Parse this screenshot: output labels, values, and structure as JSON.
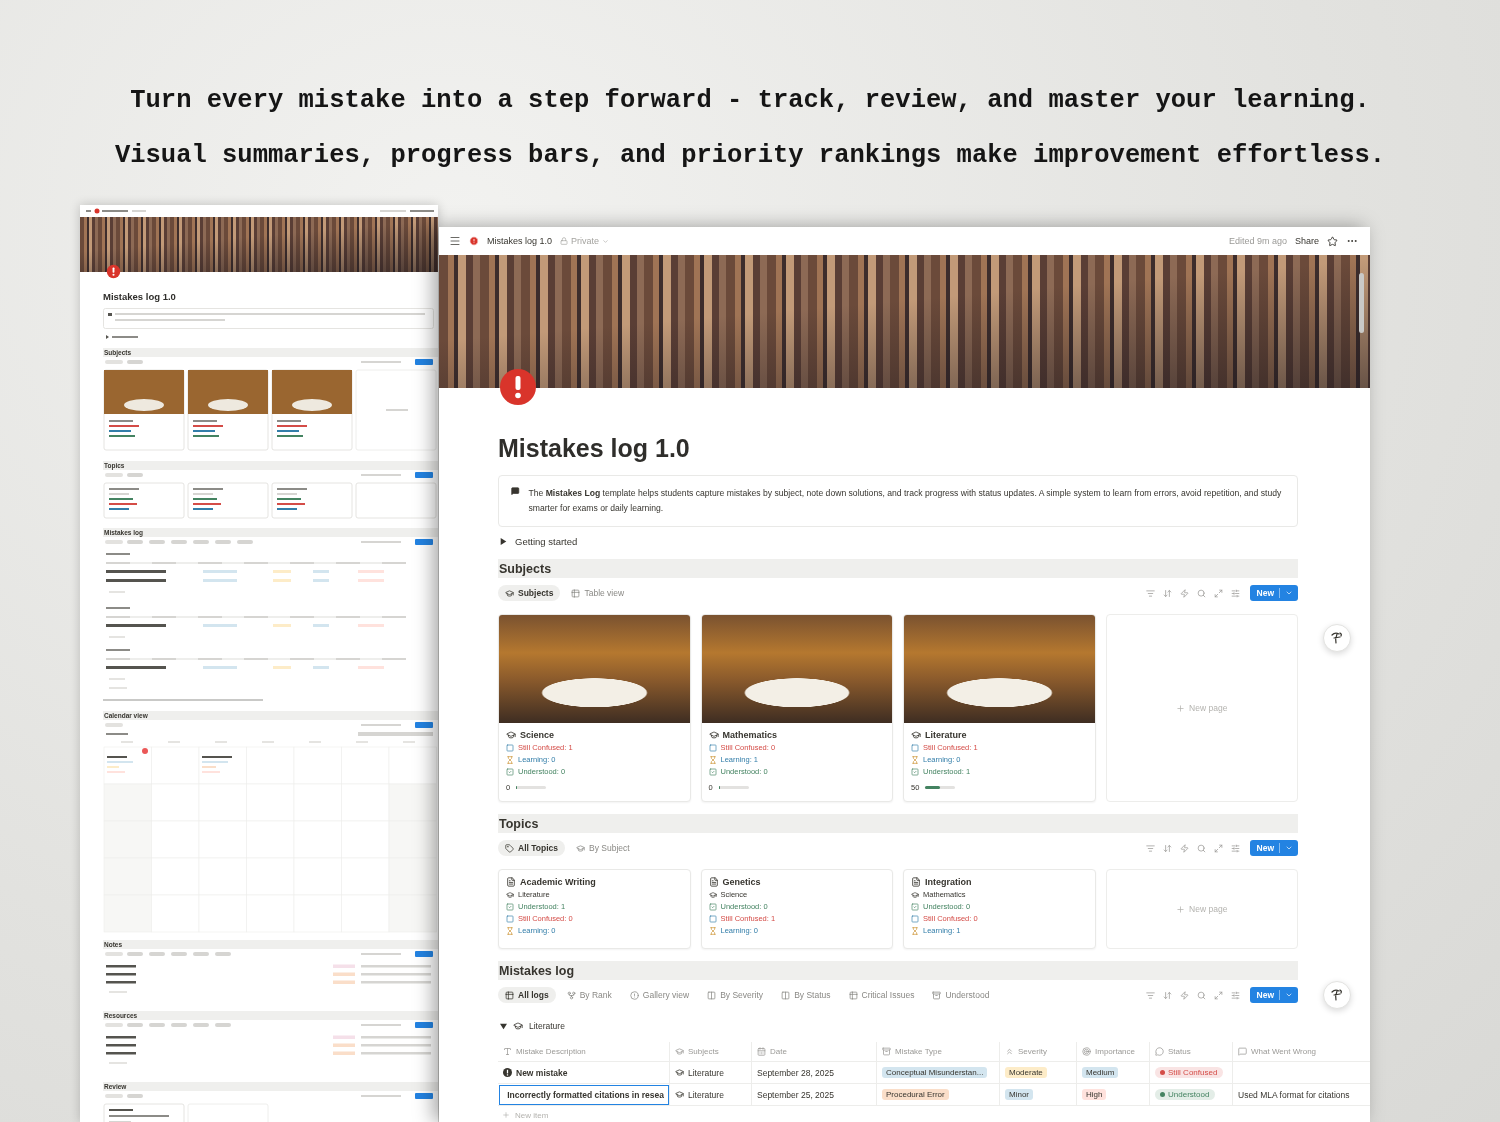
{
  "headline": [
    "Turn every mistake into a step forward - track, review, and master your learning.",
    "Visual summaries, progress bars, and priority rankings make improvement effortless."
  ],
  "back_page": {
    "title": "Mistakes log 1.0",
    "sections": [
      {
        "title": "Subjects",
        "kind": "photo_gallery"
      },
      {
        "title": "Topics",
        "kind": "gallery"
      },
      {
        "title": "Mistakes log",
        "kind": "table"
      },
      {
        "title": "Calendar view",
        "kind": "calendar"
      },
      {
        "title": "Notes",
        "kind": "list"
      },
      {
        "title": "Resources",
        "kind": "list"
      },
      {
        "title": "Review",
        "kind": "board"
      }
    ]
  },
  "front_page": {
    "topbar": {
      "title": "Mistakes log 1.0",
      "privacy": "Private",
      "edited": "Edited 9m ago",
      "share": "Share"
    },
    "title": "Mistakes log 1.0",
    "description": "The **Mistakes Log** template helps students capture mistakes by subject, note down solutions, and track progress with status updates. A simple system to learn from errors, avoid repetition, and study smarter for exams or daily learning.",
    "toggle": "Getting started",
    "sections": [
      {
        "title": "Subjects",
        "views": [
          {
            "label": "Subjects",
            "kind": "subject",
            "selected": true
          },
          {
            "label": "Table view",
            "kind": "table",
            "selected": false
          }
        ],
        "new_button": "New",
        "body": {
          "kind": "photo_gallery",
          "new_page": "New page",
          "cards": [
            {
              "name": "Science",
              "lines": [
                {
                  "kind": "confused",
                  "text": "Still Confused: 1"
                },
                {
                  "kind": "learning",
                  "text": "Learning: 0"
                },
                {
                  "kind": "understood",
                  "text": "Understood: 0"
                }
              ],
              "progress": {
                "text": "0",
                "level": 0
              }
            },
            {
              "name": "Mathematics",
              "lines": [
                {
                  "kind": "confused",
                  "text": "Still Confused: 0"
                },
                {
                  "kind": "learning",
                  "text": "Learning: 1"
                },
                {
                  "kind": "understood",
                  "text": "Understood: 0"
                }
              ],
              "progress": {
                "text": "0",
                "level": 0
              }
            },
            {
              "name": "Literature",
              "lines": [
                {
                  "kind": "confused",
                  "text": "Still Confused: 1"
                },
                {
                  "kind": "learning",
                  "text": "Learning: 0"
                },
                {
                  "kind": "understood",
                  "text": "Understood: 1"
                }
              ],
              "progress": {
                "text": "50",
                "level": 0.5
              }
            }
          ]
        }
      },
      {
        "title": "Topics",
        "views": [
          {
            "label": "All Topics",
            "kind": "tag",
            "selected": true
          },
          {
            "label": "By Subject",
            "kind": "subject",
            "selected": false
          }
        ],
        "new_button": "New",
        "body": {
          "kind": "gallery",
          "new_page": "New page",
          "cards": [
            {
              "name": "Academic Writing",
              "lines": [
                {
                  "kind": "subject",
                  "text": "Literature"
                },
                {
                  "kind": "understood",
                  "text": "Understood: 1"
                },
                {
                  "kind": "confused",
                  "text": "Still Confused: 0"
                },
                {
                  "kind": "learning",
                  "text": "Learning: 0"
                }
              ]
            },
            {
              "name": "Genetics",
              "lines": [
                {
                  "kind": "subject",
                  "text": "Science"
                },
                {
                  "kind": "understood",
                  "text": "Understood: 0"
                },
                {
                  "kind": "confused",
                  "text": "Still Confused: 1"
                },
                {
                  "kind": "learning",
                  "text": "Learning: 0"
                }
              ]
            },
            {
              "name": "Integration",
              "lines": [
                {
                  "kind": "subject",
                  "text": "Mathematics"
                },
                {
                  "kind": "understood",
                  "text": "Understood: 0"
                },
                {
                  "kind": "confused",
                  "text": "Still Confused: 0"
                },
                {
                  "kind": "learning",
                  "text": "Learning: 1"
                }
              ]
            }
          ]
        }
      },
      {
        "title": "Mistakes log",
        "views": [
          {
            "label": "All logs",
            "kind": "table",
            "selected": true
          },
          {
            "label": "By Rank",
            "kind": "rank",
            "selected": false
          },
          {
            "label": "Gallery view",
            "kind": "alert",
            "selected": false
          },
          {
            "label": "By Severity",
            "kind": "board",
            "selected": false
          },
          {
            "label": "By Status",
            "kind": "board",
            "selected": false
          },
          {
            "label": "Critical Issues",
            "kind": "table",
            "selected": false
          },
          {
            "label": "Understood",
            "kind": "archive",
            "selected": false
          }
        ],
        "new_button": "New",
        "body": {
          "kind": "table",
          "groups": [
            {
              "name": "Literature",
              "new_item": "New item",
              "columns": [
                {
                  "label": "Mistake Description",
                  "kind": "title"
                },
                {
                  "label": "Subjects",
                  "kind": "subject"
                },
                {
                  "label": "Date",
                  "kind": "date"
                },
                {
                  "label": "Mistake Type",
                  "kind": "select"
                },
                {
                  "label": "Severity",
                  "kind": "severity"
                },
                {
                  "label": "Importance",
                  "kind": "importance"
                },
                {
                  "label": "Status",
                  "kind": "status"
                },
                {
                  "label": "What Went Wrong",
                  "kind": "text"
                }
              ],
              "rows": [
                {
                  "selected": false,
                  "cells": [
                    {
                      "kind": "title",
                      "text": "New mistake"
                    },
                    {
                      "kind": "subject",
                      "text": "Literature"
                    },
                    {
                      "kind": "text",
                      "text": "September 28, 2025"
                    },
                    {
                      "kind": "tag",
                      "text": "Conceptual Misunderstan...",
                      "color": "#d3e5ef"
                    },
                    {
                      "kind": "tag",
                      "text": "Moderate",
                      "color": "#fdecc8"
                    },
                    {
                      "kind": "tag",
                      "text": "Medium",
                      "color": "#d3e5ef"
                    },
                    {
                      "kind": "status",
                      "text": "Still Confused",
                      "color": "#d44c47"
                    }
                  ]
                },
                {
                  "selected": true,
                  "cells": [
                    {
                      "kind": "title",
                      "text": "Incorrectly formatted citations in resea"
                    },
                    {
                      "kind": "subject",
                      "text": "Literature"
                    },
                    {
                      "kind": "text",
                      "text": "September 25, 2025"
                    },
                    {
                      "kind": "tag",
                      "text": "Procedural Error",
                      "color": "#fadec9"
                    },
                    {
                      "kind": "tag",
                      "text": "Minor",
                      "color": "#d3e5ef"
                    },
                    {
                      "kind": "tag",
                      "text": "High",
                      "color": "#ffe2dd"
                    },
                    {
                      "kind": "status",
                      "text": "Understood",
                      "color": "#448361"
                    },
                    {
                      "kind": "text",
                      "text": "Used MLA format for citations"
                    }
                  ]
                }
              ]
            }
          ]
        }
      }
    ]
  }
}
